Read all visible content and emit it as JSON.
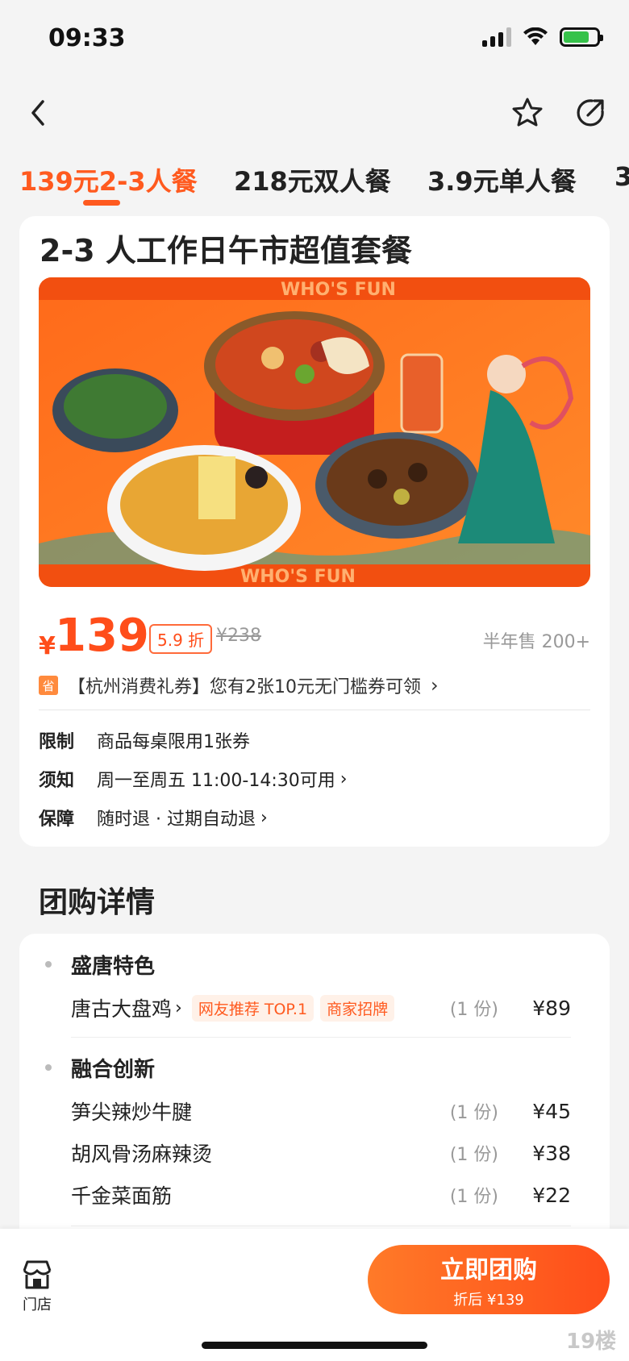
{
  "status_bar": {
    "time": "09:33"
  },
  "tabs": [
    {
      "label": "139元2-3人餐",
      "active": true
    },
    {
      "label": "218元双人餐",
      "active": false
    },
    {
      "label": "3.9元单人餐",
      "active": false
    },
    {
      "label": "3",
      "active": false
    }
  ],
  "deal": {
    "title": "2-3 人工作日午市超值套餐",
    "hero_banner_text": "WHO'S FUN",
    "price_symbol": "¥",
    "price": "139",
    "discount": "5.9 折",
    "original_price": "¥238",
    "sold": "半年售 200+",
    "coupon_icon": "省",
    "coupon_text": "【杭州消费礼券】您有2张10元无门槛券可领",
    "rules": [
      {
        "label": "限制",
        "value": "商品每桌限用1张券",
        "has_chevron": false
      },
      {
        "label": "须知",
        "value": "周一至周五 11:00-14:30可用",
        "has_chevron": true
      },
      {
        "label": "保障",
        "value": "随时退 · 过期自动退",
        "has_chevron": true
      }
    ]
  },
  "detail": {
    "section_title": "团购详情",
    "groups": [
      {
        "title": "盛唐特色",
        "items": [
          {
            "name": "唐古大盘鸡",
            "tags": [
              "网友推荐 TOP.1",
              "商家招牌"
            ],
            "qty": "(1 份)",
            "price": "¥89"
          }
        ]
      },
      {
        "title": "融合创新",
        "items": [
          {
            "name": "笋尖辣炒牛腱",
            "qty": "(1 份)",
            "price": "¥45"
          },
          {
            "name": "胡风骨汤麻辣烫",
            "qty": "(1 份)",
            "price": "¥38"
          },
          {
            "name": "千金菜面筋",
            "qty": "(1 份)",
            "price": "¥22"
          }
        ]
      }
    ]
  },
  "bottom_bar": {
    "store_label": "门店",
    "buy_label": "立即团购",
    "buy_sub": "折后 ¥139"
  },
  "watermark_text": "19楼",
  "colors": {
    "accent": "#ff5a1f",
    "price": "#ff4d1a",
    "background": "#f4f4f4"
  }
}
